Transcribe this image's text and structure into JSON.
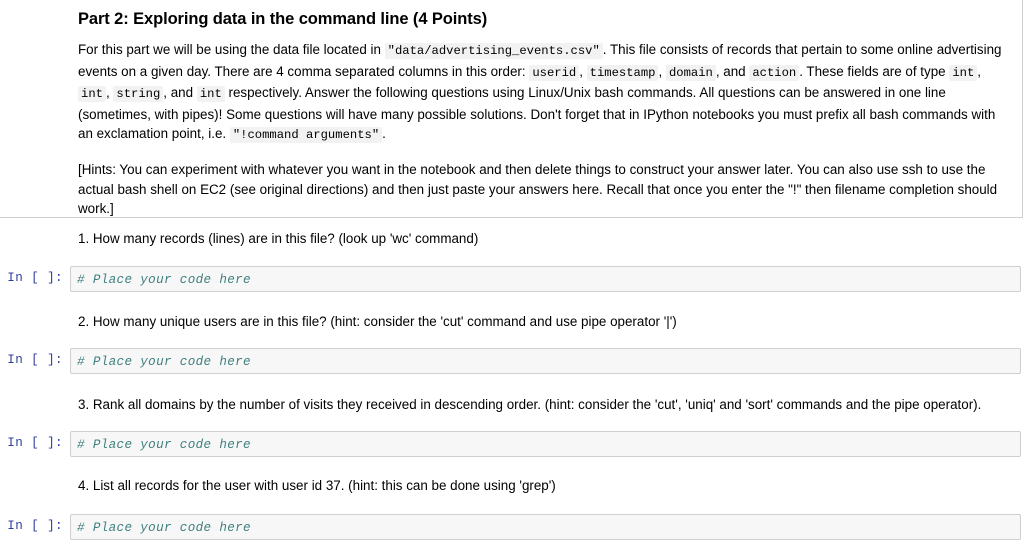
{
  "notebook": {
    "markdown_cell": {
      "heading": "Part 2: Exploring data in the command line (4 Points)",
      "paragraph1": {
        "seg1": "For this part we will be using the data file located in ",
        "code1": "\"data/advertising_events.csv\"",
        "seg2": ". This file consists of records that pertain to some online advertising events on a given day. There are 4 comma separated columns in this order: ",
        "code2": "userid",
        "seg3": ", ",
        "code3": "timestamp",
        "seg4": ", ",
        "code4": "domain",
        "seg5": ", and ",
        "code5": "action",
        "seg6": ". These fields are of type ",
        "code6": "int",
        "seg7": ", ",
        "code7": "int",
        "seg8": ", ",
        "code8": "string",
        "seg9": ", and ",
        "code9": "int",
        "seg10": " respectively. Answer the following questions using Linux/Unix bash commands. All questions can be answered in one line (sometimes, with pipes)! Some questions will have many possible solutions. Don't forget that in IPython notebooks you must prefix all bash commands with an exclamation point, i.e. ",
        "code10": "\"!command arguments\"",
        "seg11": "."
      },
      "paragraph2": "[Hints: You can experiment with whatever you want in the notebook and then delete things to construct your answer later. You can also use ssh to use the actual bash shell on EC2 (see original directions) and then just paste your answers here. Recall that once you enter the \"!\" then filename completion should work.]"
    },
    "questions": [
      {
        "text": "1. How many records (lines) are in this file? (look up 'wc' command)",
        "prompt": "In [ ]:",
        "code_placeholder": "# Place your code here"
      },
      {
        "text": "2. How many unique users are in this file? (hint: consider the 'cut' command and use pipe operator '|')",
        "prompt": "In [ ]:",
        "code_placeholder": "# Place your code here"
      },
      {
        "text": "3. Rank all domains by the number of visits they received in descending order. (hint: consider the 'cut', 'uniq' and 'sort' commands and the pipe operator).",
        "prompt": "In [ ]:",
        "code_placeholder": "# Place your code here"
      },
      {
        "text": "4. List all records for the user with user id 37. (hint: this can be done using 'grep')",
        "prompt": "In [ ]:",
        "code_placeholder": "# Place your code here"
      }
    ],
    "colors": {
      "prompt_blue": "#303f9f",
      "comment_teal": "#408080",
      "cell_background": "#f7f7f7",
      "cell_border": "#cfcfcf",
      "inline_code_background": "#f2f2f2",
      "page_background": "#ffffff",
      "text": "#000000"
    }
  }
}
